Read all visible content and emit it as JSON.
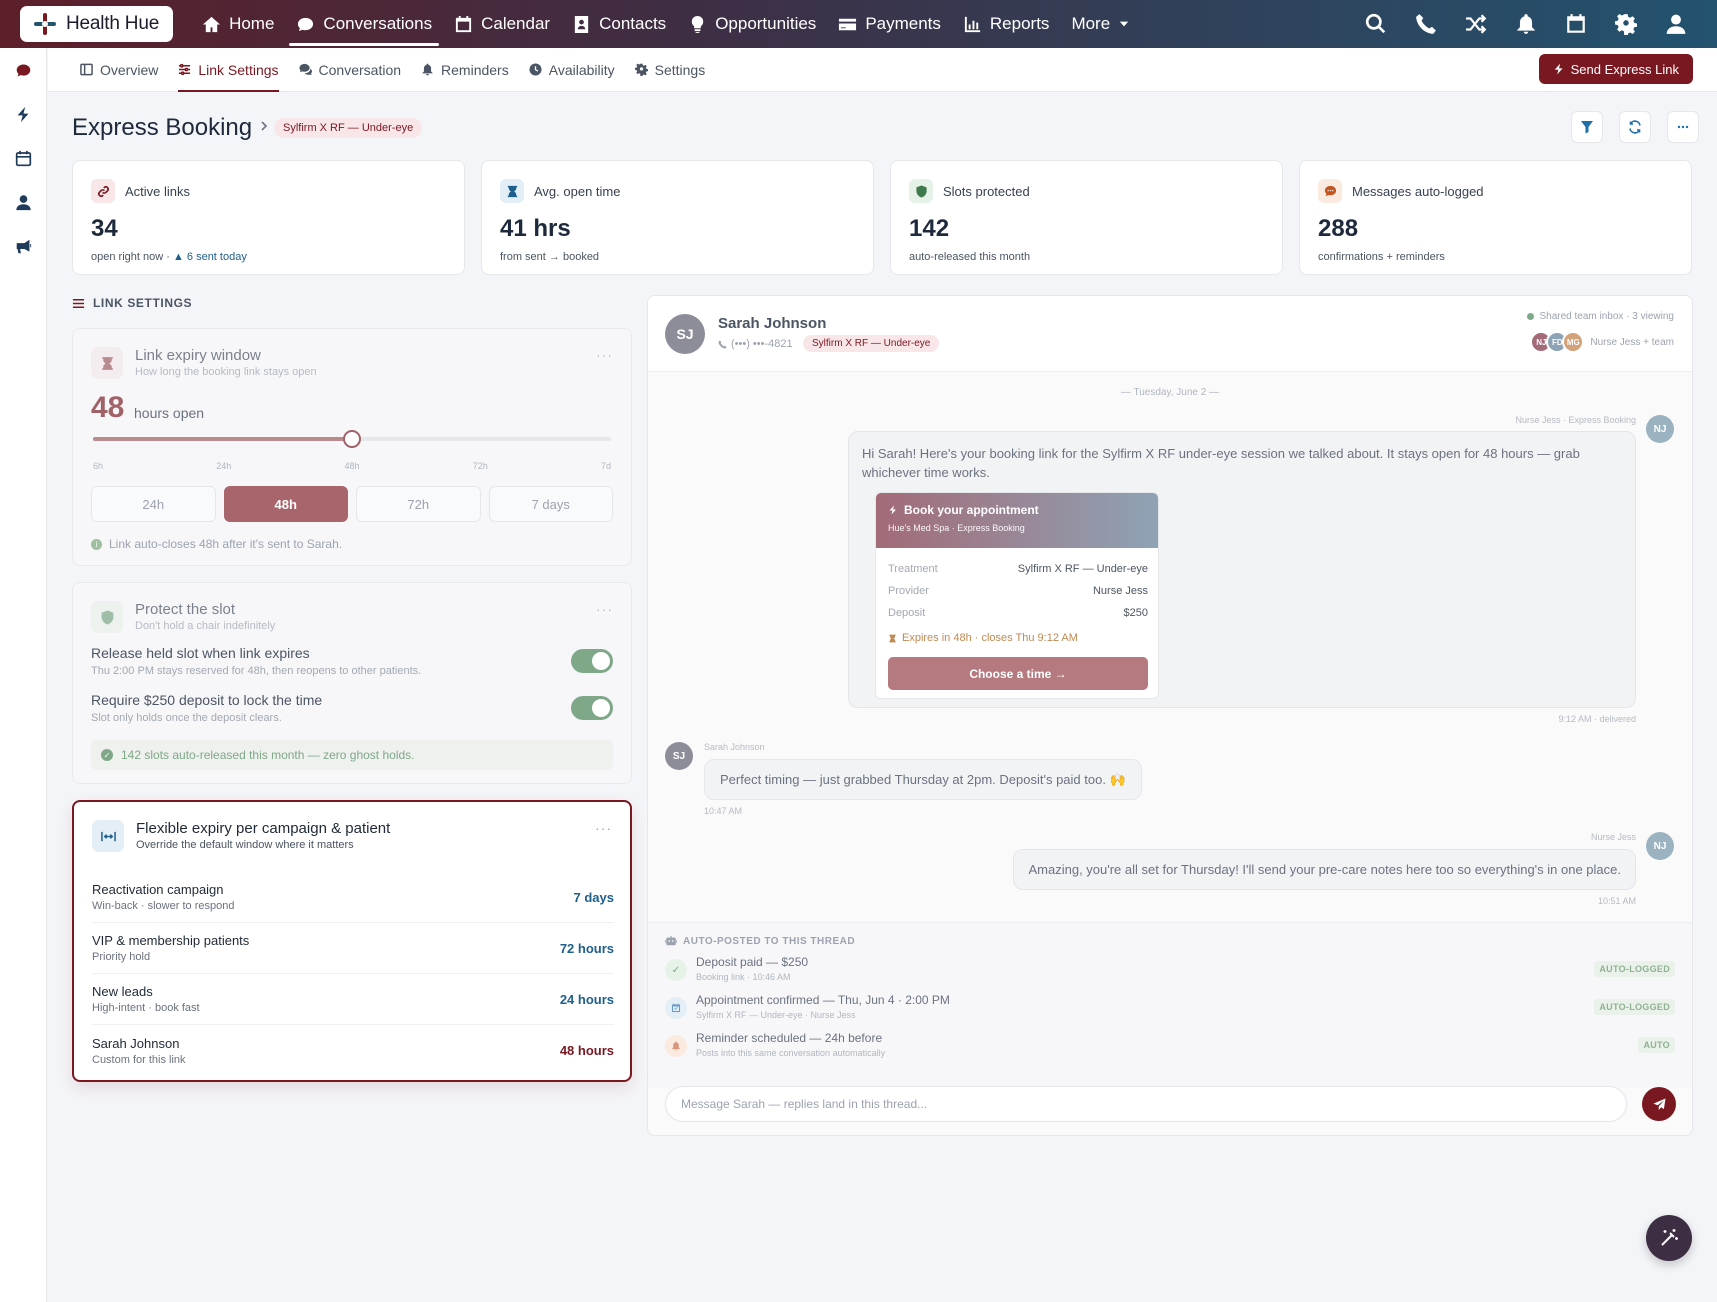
{
  "app": {
    "name": "Health Hue"
  },
  "nav": {
    "items": [
      {
        "label": "Home",
        "icon": "home-icon"
      },
      {
        "label": "Conversations",
        "icon": "chat-icon",
        "active": true
      },
      {
        "label": "Calendar",
        "icon": "calendar-icon"
      },
      {
        "label": "Contacts",
        "icon": "contact-card-icon"
      },
      {
        "label": "Opportunities",
        "icon": "lightbulb-icon"
      },
      {
        "label": "Payments",
        "icon": "credit-card-icon"
      },
      {
        "label": "Reports",
        "icon": "bar-chart-icon"
      },
      {
        "label": "More",
        "icon": "caret-down-icon"
      }
    ],
    "right_icons": [
      "search-icon",
      "phone-icon",
      "shuffle-icon",
      "bell-icon",
      "calendar-icon",
      "gear-icon",
      "user-icon"
    ]
  },
  "rail": {
    "icons": [
      "chat-icon",
      "bolt-icon",
      "calendar-icon",
      "user-icon",
      "megaphone-icon"
    ]
  },
  "subnav": {
    "tabs": [
      {
        "label": "Overview",
        "icon": "columns-icon"
      },
      {
        "label": "Link Settings",
        "icon": "sliders-icon",
        "active": true
      },
      {
        "label": "Conversation",
        "icon": "comments-icon"
      },
      {
        "label": "Reminders",
        "icon": "bell-icon"
      },
      {
        "label": "Availability",
        "icon": "clock-icon"
      },
      {
        "label": "Settings",
        "icon": "gear-icon"
      }
    ],
    "send_button": "Send Express Link"
  },
  "page": {
    "title": "Express Booking",
    "tag": "Sylfirm X RF — Under-eye"
  },
  "stats": [
    {
      "label": "Active links",
      "value": "34",
      "sub": "open right now ·",
      "sub_accent": "▲ 6 sent today",
      "icon": "link-icon",
      "color": "#7a1822",
      "bg": "#f8e6e8"
    },
    {
      "label": "Avg. open time",
      "value": "41 hrs",
      "sub": "from sent → booked",
      "sub_accent": "",
      "icon": "hourglass-icon",
      "color": "#1f5f8b",
      "bg": "#e4eef6"
    },
    {
      "label": "Slots protected",
      "value": "142",
      "sub": "auto-released this month",
      "sub_accent": "",
      "icon": "shield-icon",
      "color": "#3f7a4c",
      "bg": "#e6f1e8"
    },
    {
      "label": "Messages auto-logged",
      "value": "288",
      "sub": "confirmations + reminders",
      "sub_accent": "",
      "icon": "comment-dots-icon",
      "color": "#c2551f",
      "bg": "#fbeadf"
    }
  ],
  "settings": {
    "section_label": "LINK SETTINGS",
    "expiry": {
      "title": "Link expiry window",
      "sub": "How long the booking link stays open",
      "value": "48",
      "unit": "hours open",
      "slider_fraction": 0.5,
      "ticks": [
        "6h",
        "24h",
        "48h",
        "72h",
        "7d"
      ],
      "options": [
        "24h",
        "48h",
        "72h",
        "7 days"
      ],
      "selected": 1,
      "note": "Link auto-closes 48h after it's sent to Sarah."
    },
    "protect": {
      "title": "Protect the slot",
      "sub": "Don't hold a chair indefinitely",
      "toggles": [
        {
          "label": "Release held slot when link expires",
          "sub": "Thu 2:00 PM stays reserved for 48h, then reopens to other patients.",
          "on": true
        },
        {
          "label": "Require $250 deposit to lock the time",
          "sub": "Slot only holds once the deposit clears.",
          "on": true
        }
      ],
      "note": "142 slots auto-released this month — zero ghost holds."
    },
    "flex": {
      "title": "Flexible expiry per campaign & patient",
      "sub": "Override the default window where it matters",
      "rows": [
        {
          "name": "Reactivation campaign",
          "sub": "Win-back · slower to respond",
          "value": "7 days"
        },
        {
          "name": "VIP & membership patients",
          "sub": "Priority hold",
          "value": "72 hours"
        },
        {
          "name": "New leads",
          "sub": "High-intent · book fast",
          "value": "24 hours"
        },
        {
          "name": "Sarah Johnson",
          "sub": "Custom for this link",
          "value": "48 hours"
        }
      ]
    }
  },
  "conversation": {
    "contact": {
      "initials": "SJ",
      "name": "Sarah Johnson",
      "phone": "(•••) •••-4821",
      "tag": "Sylfirm X RF — Under-eye"
    },
    "inbox": "Shared team inbox · 3 viewing",
    "viewers": [
      {
        "initials": "NJ",
        "color": "#a36a77"
      },
      {
        "initials": "FD",
        "color": "#8ea3b5"
      },
      {
        "initials": "MG",
        "color": "#d4a27a"
      }
    ],
    "viewers_label": "Nurse Jess + team",
    "day": "— Tuesday, June 2 —",
    "msg1": {
      "sender": "Nurse Jess · Express Booking",
      "avatar": "NJ",
      "text": "Hi Sarah! Here's your booking link for the Sylfirm X RF under-eye session we talked about. It stays open for 48 hours — grab whichever time works.",
      "time": "9:12 AM · delivered",
      "card": {
        "title": "Book your appointment",
        "sub": "Hue's Med Spa · Express Booking",
        "rows": [
          {
            "k": "Treatment",
            "v": "Sylfirm X RF — Under-eye"
          },
          {
            "k": "Provider",
            "v": "Nurse Jess"
          },
          {
            "k": "Deposit",
            "v": "$250"
          }
        ],
        "expires": "Expires in 48h · closes Thu 9:12 AM",
        "button": "Choose a time →"
      }
    },
    "msg2": {
      "sender": "Sarah Johnson",
      "avatar": "SJ",
      "text": "Perfect timing — just grabbed Thursday at 2pm. Deposit's paid too. 🙌",
      "time": "10:47 AM"
    },
    "msg3": {
      "sender": "Nurse Jess",
      "avatar": "NJ",
      "text": "Amazing, you're all set for Thursday! I'll send your pre-care notes here too so everything's in one place.",
      "time": "10:51 AM"
    },
    "auto": {
      "label": "AUTO-POSTED TO THIS THREAD",
      "events": [
        {
          "title": "Deposit paid — $250",
          "sub": "Booking link · 10:46 AM",
          "badge": "AUTO-LOGGED",
          "icon": "check-icon",
          "color": "#7fa889",
          "bg": "#e6f1e8"
        },
        {
          "title": "Appointment confirmed — Thu, Jun 4 · 2:00 PM",
          "sub": "Sylfirm X RF — Under-eye · Nurse Jess",
          "badge": "AUTO-LOGGED",
          "icon": "calendar-check-icon",
          "color": "#6b9bc2",
          "bg": "#e4eef6"
        },
        {
          "title": "Reminder scheduled — 24h before",
          "sub": "Posts into this same conversation automatically",
          "badge": "AUTO",
          "icon": "bell-icon",
          "color": "#d9957b",
          "bg": "#fbeadf"
        }
      ]
    },
    "composer_placeholder": "Message Sarah — replies land in this thread..."
  }
}
